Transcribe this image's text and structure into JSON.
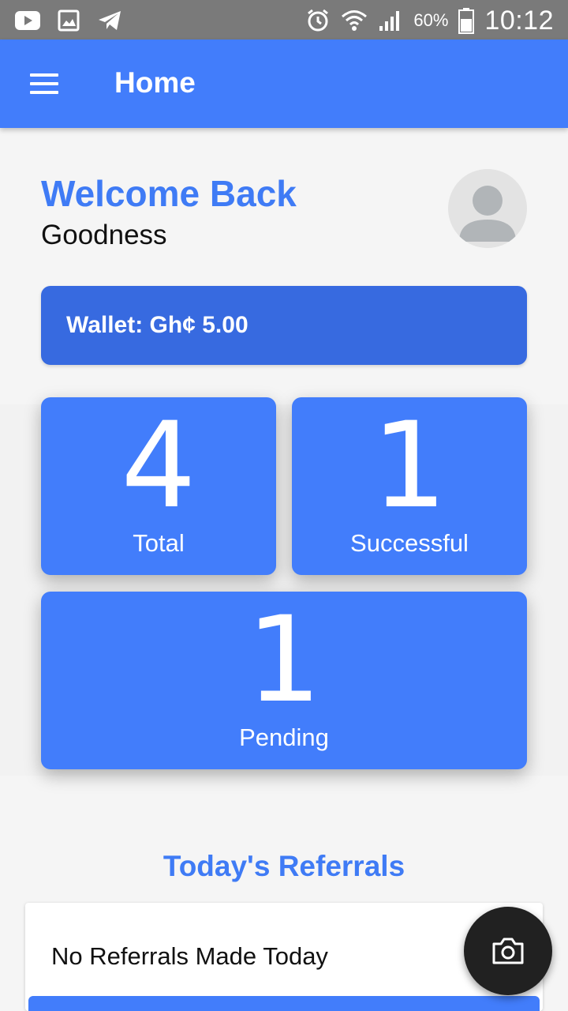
{
  "status_bar": {
    "left_icons": [
      "youtube-icon",
      "gallery-icon",
      "telegram-icon"
    ],
    "right_icons": [
      "alarm-icon",
      "wifi-icon",
      "signal-icon",
      "battery-icon"
    ],
    "battery": "60%",
    "time": "10:12"
  },
  "app_bar": {
    "title": "Home",
    "menu_icon": "menu-icon"
  },
  "welcome": {
    "heading": "Welcome Back",
    "username": "Goodness",
    "avatar_icon": "person-icon"
  },
  "wallet": {
    "text": "Wallet: Gh¢ 5.00"
  },
  "stats": {
    "total": {
      "value": "4",
      "label": "Total"
    },
    "successful": {
      "value": "1",
      "label": "Successful"
    },
    "pending": {
      "value": "1",
      "label": "Pending"
    }
  },
  "referrals": {
    "title": "Today's Referrals",
    "empty_text": "No Referrals Made Today"
  },
  "fab": {
    "icon": "camera-icon"
  },
  "colors": {
    "primary": "#427dfb",
    "wallet": "#376ae0",
    "heading": "#3f7bf5",
    "fab": "#212121",
    "status_bar": "#7a7a7a"
  }
}
